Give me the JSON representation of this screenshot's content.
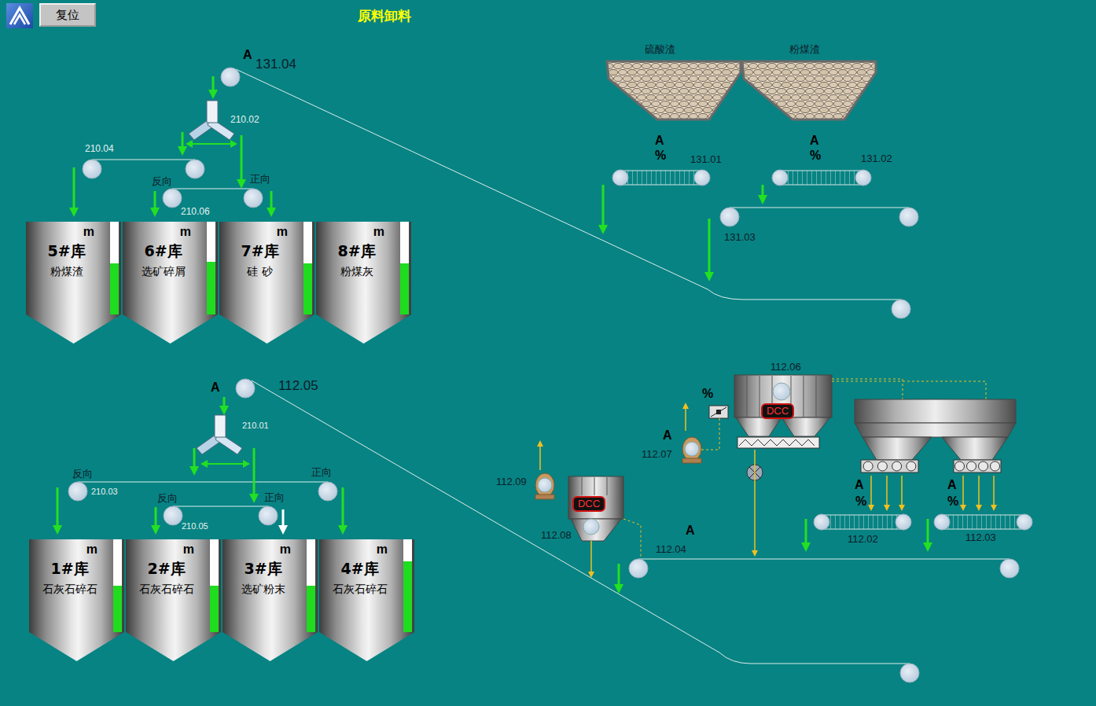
{
  "toolbar": {
    "reset_button": "复位",
    "title": "原料卸料"
  },
  "upper_silos": [
    {
      "number": "5#库",
      "material": "粉煤渣",
      "unit": "m",
      "level": 0.55,
      "has_inlet": true,
      "inlet_active": true
    },
    {
      "number": "6#库",
      "material": "选矿碎屑",
      "unit": "m",
      "level": 0.57,
      "has_inlet": true,
      "inlet_active": true
    },
    {
      "number": "7#库",
      "material": "硅 砂",
      "unit": "m",
      "level": 0.55,
      "has_inlet": true,
      "inlet_active": true
    },
    {
      "number": "8#库",
      "material": "粉煤灰",
      "unit": "m",
      "level": 0.55,
      "has_inlet": false,
      "inlet_active": false
    }
  ],
  "lower_silos": [
    {
      "number": "1#库",
      "material": "石灰石碎石",
      "unit": "m",
      "level": 0.5,
      "has_inlet": true,
      "inlet_active": true
    },
    {
      "number": "2#库",
      "material": "石灰石碎石",
      "unit": "m",
      "level": 0.5,
      "has_inlet": true,
      "inlet_active": true
    },
    {
      "number": "3#库",
      "material": "选矿粉末",
      "unit": "m",
      "level": 0.5,
      "has_inlet": true,
      "inlet_active": false
    },
    {
      "number": "4#库",
      "material": "石灰石碎石",
      "unit": "m",
      "level": 0.76,
      "has_inlet": true,
      "inlet_active": true
    }
  ],
  "dust_collectors": [
    {
      "badge": "DCC"
    },
    {
      "badge": "DCC"
    }
  ],
  "labels": [
    "A",
    "131.04",
    "210.02",
    "210.04",
    "反向",
    "正向",
    "210.06",
    "A",
    "112.05",
    "210.01",
    "反向",
    "210.03",
    "正向",
    "反向",
    "正向",
    "210.05",
    "硫酸渣",
    "粉煤渣",
    "A",
    "%",
    "131.01",
    "A",
    "%",
    "131.02",
    "131.03",
    "112.06",
    "%",
    "A",
    "112.07",
    "112.09",
    "112.08",
    "A",
    "112.04",
    "A",
    "%",
    "112.02",
    "A",
    "%",
    "112.03"
  ]
}
